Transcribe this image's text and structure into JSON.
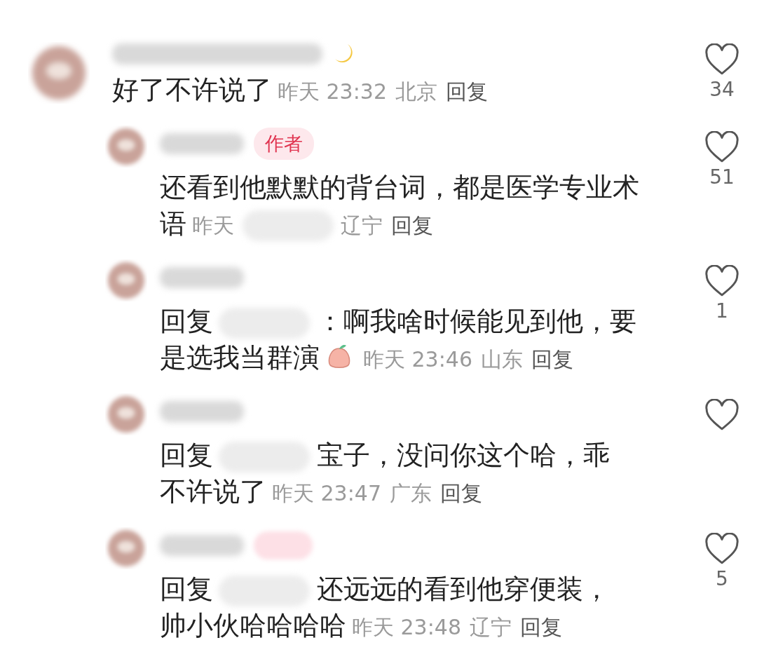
{
  "comments": [
    {
      "name_emoji": true,
      "body": [
        {
          "kind": "text",
          "text": "好了不许说了"
        },
        {
          "kind": "meta",
          "text": "昨天 23:32"
        },
        {
          "kind": "meta",
          "text": "北京"
        },
        {
          "kind": "action",
          "text": "回复"
        }
      ],
      "likes": "34",
      "replies": [
        {
          "badge": {
            "kind": "text",
            "text": "作者"
          },
          "body": [
            {
              "kind": "text",
              "text": "还看到他默默的背台词，都是医学专业术"
            },
            {
              "kind": "text",
              "text": "语"
            },
            {
              "kind": "meta",
              "text": "昨天"
            },
            {
              "kind": "blur"
            },
            {
              "kind": "meta",
              "text": "辽宁"
            },
            {
              "kind": "action",
              "text": "回复"
            }
          ],
          "likes": "51"
        },
        {
          "body": [
            {
              "kind": "text",
              "text": "回复"
            },
            {
              "kind": "blur"
            },
            {
              "kind": "text",
              "text": "：啊我啥时候能见到他，要"
            },
            {
              "kind": "text",
              "text": "是选我当群演"
            },
            {
              "kind": "emoji"
            },
            {
              "kind": "meta",
              "text": "昨天 23:46"
            },
            {
              "kind": "meta",
              "text": "山东"
            },
            {
              "kind": "action",
              "text": "回复"
            }
          ],
          "likes": "1"
        },
        {
          "body": [
            {
              "kind": "text",
              "text": "回复"
            },
            {
              "kind": "blur"
            },
            {
              "kind": "text",
              "text": "宝子，没问你这个哈，乖"
            },
            {
              "kind": "text",
              "text": "不许说了"
            },
            {
              "kind": "meta",
              "text": "昨天 23:47"
            },
            {
              "kind": "meta",
              "text": "广东"
            },
            {
              "kind": "action",
              "text": "回复"
            }
          ]
        },
        {
          "badge": {
            "kind": "blurred"
          },
          "body": [
            {
              "kind": "text",
              "text": "回复"
            },
            {
              "kind": "blur"
            },
            {
              "kind": "text",
              "text": "还远远的看到他穿便装，"
            },
            {
              "kind": "text",
              "text": "帅小伙哈哈哈哈"
            },
            {
              "kind": "meta",
              "text": "昨天 23:48"
            },
            {
              "kind": "meta",
              "text": "辽宁"
            },
            {
              "kind": "action",
              "text": "回复"
            }
          ],
          "likes": "5"
        }
      ]
    }
  ]
}
